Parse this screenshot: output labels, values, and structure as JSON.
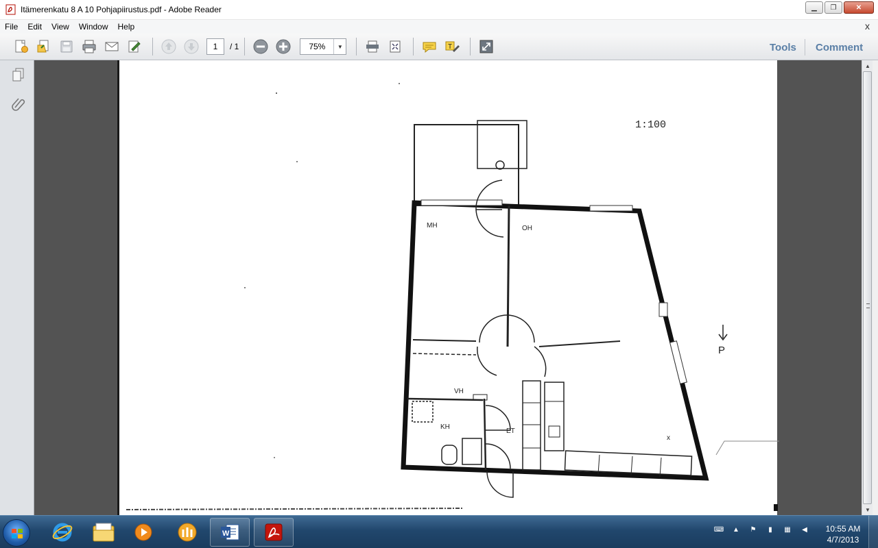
{
  "window": {
    "title": "Itämerenkatu 8 A 10 Pohjapiirustus.pdf - Adobe Reader",
    "app_icon": "adobe-reader-icon",
    "controls": [
      "minimize",
      "maximize",
      "close"
    ]
  },
  "menubar": {
    "items": [
      "File",
      "Edit",
      "View",
      "Window",
      "Help"
    ],
    "close_glyph": "x"
  },
  "toolbar": {
    "page_current": "1",
    "page_total": "/ 1",
    "zoom": "75%",
    "tools_label": "Tools",
    "comment_label": "Comment",
    "accent": "#5a7fa6"
  },
  "document": {
    "scale_label": "1:100",
    "rooms": {
      "mh": "MH",
      "oh": "OH",
      "vh": "VH",
      "kh": "KH",
      "et": "ET"
    },
    "north_label": "P",
    "mark_x": "x"
  },
  "taskbar": {
    "apps": [
      "internet-explorer-icon",
      "windows-explorer-icon",
      "media-player-icon",
      "app-icon",
      "microsoft-word-icon",
      "adobe-reader-icon"
    ],
    "clock_time": "10:55 AM",
    "clock_date": "4/7/2013"
  }
}
